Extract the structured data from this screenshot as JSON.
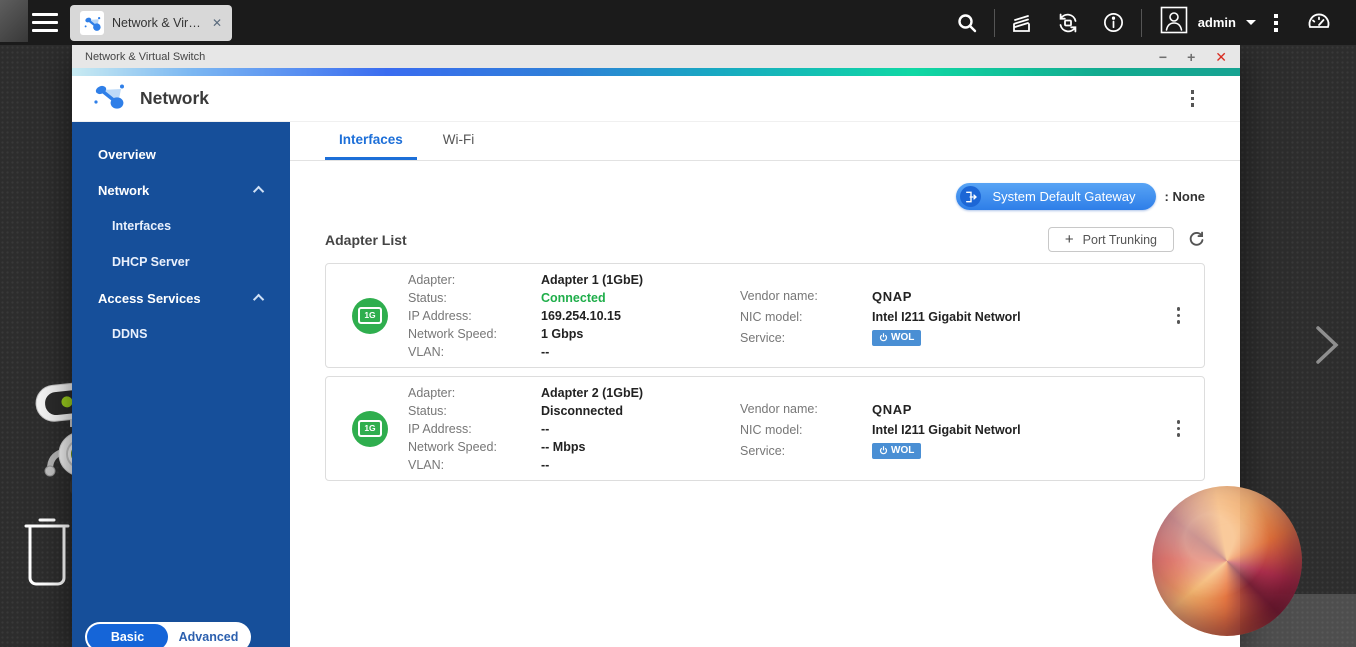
{
  "colors": {
    "accent_blue": "#1d6fd8",
    "sidebar_blue": "#164f9a",
    "status_connected_green": "#1fae4a",
    "close_red": "#d82c20",
    "qnap_logo_blue": "#0d3fbe",
    "wol_badge_blue": "#4a8fd4",
    "adapter_icon_green": "#2fae4e",
    "gradient_bar": [
      "#c9ebf2",
      "#3a6cf0",
      "#10d8a4",
      "#17a392"
    ]
  },
  "topbar": {
    "tab": {
      "label": "Network & Virtu...",
      "close": "✕"
    },
    "user": {
      "name": "admin"
    },
    "icons": {
      "menu": "hamburger-lines",
      "search": "magnifier",
      "background_tasks": "stacked-tray",
      "update": "circular-sync-arrows",
      "info": "i-in-circle",
      "avatar": "person-in-square",
      "more": "kebab-dots",
      "dashboard": "gauge"
    }
  },
  "window": {
    "titlebar": {
      "title": "Network & Virtual Switch",
      "minimize": "−",
      "maximize": "+",
      "close": "✕"
    },
    "header": {
      "title": "Network"
    },
    "sidebar": {
      "items": [
        {
          "label": "Overview",
          "level": "top"
        },
        {
          "label": "Network",
          "level": "top",
          "expanded": true
        },
        {
          "label": "Interfaces",
          "level": "sub"
        },
        {
          "label": "DHCP Server",
          "level": "sub"
        },
        {
          "label": "Access Services",
          "level": "top",
          "expanded": true
        },
        {
          "label": "DDNS",
          "level": "sub"
        }
      ],
      "mode_toggle": {
        "basic": "Basic",
        "advanced": "Advanced",
        "selected": "Basic"
      }
    },
    "tabs": [
      {
        "label": "Interfaces",
        "active": true
      },
      {
        "label": "Wi-Fi",
        "active": false
      }
    ],
    "gateway": {
      "button_label": "System Default Gateway",
      "value": ": None"
    },
    "adapter_list": {
      "title": "Adapter List",
      "port_trunking_label": "Port Trunking",
      "plus": "+"
    },
    "adapters": [
      {
        "icon_label": "1G",
        "fields": [
          {
            "label": "Adapter:",
            "value": "Adapter 1 (1GbE)"
          },
          {
            "label": "Status:",
            "value": "Connected"
          },
          {
            "label": "IP Address:",
            "value": "169.254.10.15"
          },
          {
            "label": "Network Speed:",
            "value": "1 Gbps"
          },
          {
            "label": "VLAN:",
            "value": "--"
          }
        ],
        "details": [
          {
            "label": "Vendor name:",
            "value": "QNAP"
          },
          {
            "label": "NIC model:",
            "value": "Intel I211 Gigabit Networl"
          },
          {
            "label": "Service:",
            "value": "WOL"
          }
        ]
      },
      {
        "icon_label": "1G",
        "fields": [
          {
            "label": "Adapter:",
            "value": "Adapter 2 (1GbE)"
          },
          {
            "label": "Status:",
            "value": "Disconnected"
          },
          {
            "label": "IP Address:",
            "value": "--"
          },
          {
            "label": "Network Speed:",
            "value": "-- Mbps"
          },
          {
            "label": "VLAN:",
            "value": "--"
          }
        ],
        "details": [
          {
            "label": "Vendor name:",
            "value": "QNAP"
          },
          {
            "label": "NIC model:",
            "value": "Intel I211 Gigabit Networl"
          },
          {
            "label": "Service:",
            "value": "WOL"
          }
        ]
      }
    ]
  }
}
